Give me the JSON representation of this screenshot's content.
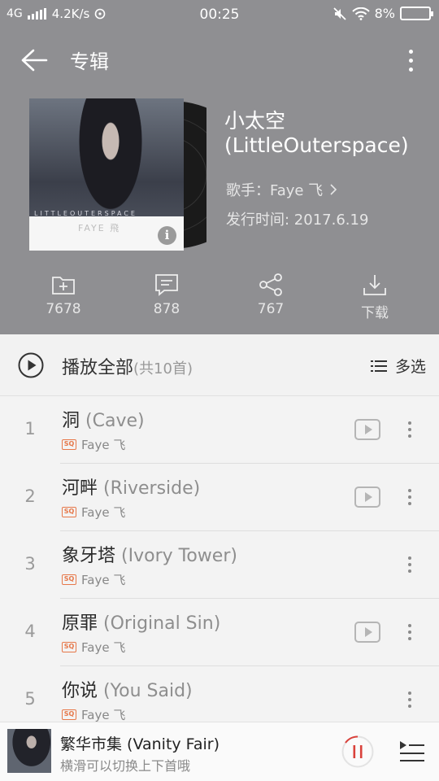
{
  "status": {
    "network": "4G",
    "speed": "4.2K/s",
    "time": "00:25",
    "battery": "8%"
  },
  "topbar": {
    "title": "专辑"
  },
  "album": {
    "title": "小太空",
    "title_en": "(LittleOuterspace)",
    "singer": "歌手：Faye 飞",
    "release": "发行时间: 2017.6.19",
    "cover_text": "LITTLEOUTERSPACE",
    "cover_logo": "FAYE 飛"
  },
  "actions": [
    {
      "icon": "add-folder-icon",
      "label": "7678"
    },
    {
      "icon": "comment-icon",
      "label": "878"
    },
    {
      "icon": "share-icon",
      "label": "767"
    },
    {
      "icon": "download-icon",
      "label": "下载"
    }
  ],
  "playall": {
    "label": "播放全部",
    "count": "(共10首)",
    "multiselect": "多选"
  },
  "songs": [
    {
      "index": "1",
      "title": "洞",
      "title_en": "(Cave)",
      "quality": "SQ",
      "artist": "Faye 飞",
      "has_mv": true
    },
    {
      "index": "2",
      "title": "河畔",
      "title_en": "(Riverside)",
      "quality": "SQ",
      "artist": "Faye 飞",
      "has_mv": true
    },
    {
      "index": "3",
      "title": "象牙塔",
      "title_en": "(Ivory Tower)",
      "quality": "SQ",
      "artist": "Faye 飞",
      "has_mv": false
    },
    {
      "index": "4",
      "title": "原罪",
      "title_en": "(Original Sin)",
      "quality": "SQ",
      "artist": "Faye 飞",
      "has_mv": true
    },
    {
      "index": "5",
      "title": "你说",
      "title_en": "(You Said)",
      "quality": "SQ",
      "artist": "Faye 飞",
      "has_mv": false
    }
  ],
  "player": {
    "title": "繁华市集 (Vanity Fair)",
    "hint": "横滑可以切换上下首哦"
  },
  "colors": {
    "header_bg": "#8f8f92",
    "accent": "#d9413b",
    "sq_badge": "#e6784a"
  }
}
